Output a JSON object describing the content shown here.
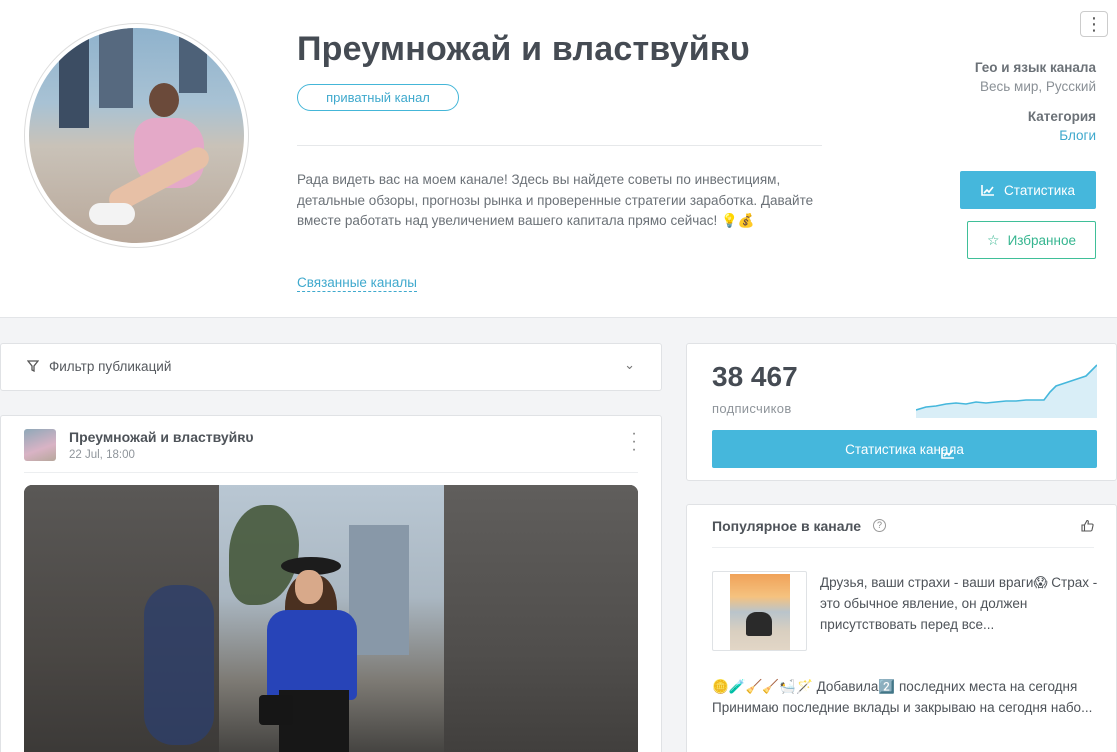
{
  "channel": {
    "title": "Преумножай и властвуйʀᴜ",
    "badge": "приватный канал",
    "description": "Рада видеть вас на моем канале! Здесь вы найдете советы по инвестициям, детальные обзоры, прогнозы рынка и проверенные стратегии заработка. Давайте вместе работать над увеличением вашего капитала прямо сейчас! 💡💰",
    "related_link": "Связанные каналы",
    "geo_heading": "Гео и язык канала",
    "geo_value": "Весь мир, Русский",
    "category_heading": "Категория",
    "category_value": "Блоги",
    "stats_button": "Статистика",
    "favorite_button": "Избранное",
    "menu_icon": "more-vertical-icon"
  },
  "filter": {
    "label": "Фильтр публикаций",
    "icon": "filter-icon"
  },
  "post": {
    "author": "Преумножай и властвуйʀᴜ",
    "date": "22 Jul, 18:00"
  },
  "subscribers": {
    "count": "38 467",
    "label": "подписчиков",
    "button": "Статистика канала",
    "accent": "#45b7dc"
  },
  "popular": {
    "heading": "Популярное в канале",
    "items": [
      {
        "text": "Друзья, ваши страхи - ваши враги😱 Страх - это обычное явление, он должен присутствовать перед все..."
      },
      {
        "text": "🪙🧪🧹🧹🛀🪄 Добавила2️⃣ последних места на сегодня Принимаю последние вклады и закрываю на сегодня набо..."
      }
    ]
  },
  "colors": {
    "primary": "#45b7dc",
    "favorite": "#3fbf98",
    "link": "#3fa9cd"
  }
}
